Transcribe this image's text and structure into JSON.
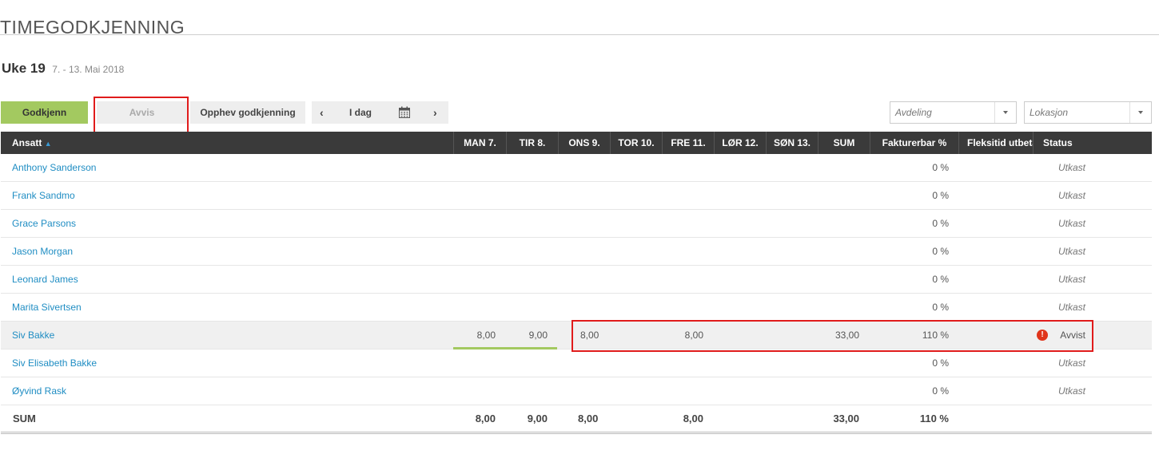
{
  "page": {
    "title": "TIMEGODKJENNING"
  },
  "week": {
    "label": "Uke 19",
    "range": "7. - 13. Mai 2018"
  },
  "toolbar": {
    "approve_label": "Godkjenn",
    "reject_label": "Avvis",
    "revoke_label": "Opphev godkjenning",
    "prev_label": "‹",
    "today_label": "I dag",
    "next_label": "›",
    "calendar_icon": "calendar-icon"
  },
  "filters": {
    "department_placeholder": "Avdeling",
    "location_placeholder": "Lokasjon"
  },
  "table": {
    "columns": {
      "employee": "Ansatt",
      "sort_indicator": "▲",
      "mon": "MAN 7.",
      "tue": "TIR 8.",
      "wed": "ONS 9.",
      "thu": "TOR 10.",
      "fri": "FRE 11.",
      "sat": "LØR 12.",
      "sun": "SØN 13.",
      "sum": "SUM",
      "billable": "Fakturerbar %",
      "flex": "Fleksitid utbetalt",
      "status": "Status"
    },
    "rows": [
      {
        "name": "Anthony Sanderson",
        "billable": "0 %",
        "status": "Utkast"
      },
      {
        "name": "Frank Sandmo",
        "billable": "0 %",
        "status": "Utkast"
      },
      {
        "name": "Grace Parsons",
        "billable": "0 %",
        "status": "Utkast"
      },
      {
        "name": "Jason Morgan",
        "billable": "0 %",
        "status": "Utkast"
      },
      {
        "name": "Leonard James",
        "billable": "0 %",
        "status": "Utkast"
      },
      {
        "name": "Marita Sivertsen",
        "billable": "0 %",
        "status": "Utkast"
      },
      {
        "name": "Siv Bakke",
        "mon": "8,00",
        "tue": "9,00",
        "wed": "8,00",
        "fri": "8,00",
        "sum": "33,00",
        "billable": "110 %",
        "status": "Avvist",
        "status_icon": "alert-icon"
      },
      {
        "name": "Siv Elisabeth Bakke",
        "billable": "0 %",
        "status": "Utkast"
      },
      {
        "name": "Øyvind Rask",
        "billable": "0 %",
        "status": "Utkast"
      }
    ],
    "totals": {
      "label": "SUM",
      "mon": "8,00",
      "tue": "9,00",
      "wed": "8,00",
      "fri": "8,00",
      "sum": "33,00",
      "billable": "110 %"
    }
  },
  "colors": {
    "accent_green": "#a3c960",
    "header_bg": "#3a3a3a",
    "link_blue": "#1f8dc3",
    "highlight_red": "#e01b1b",
    "alert_red": "#e0351b"
  }
}
